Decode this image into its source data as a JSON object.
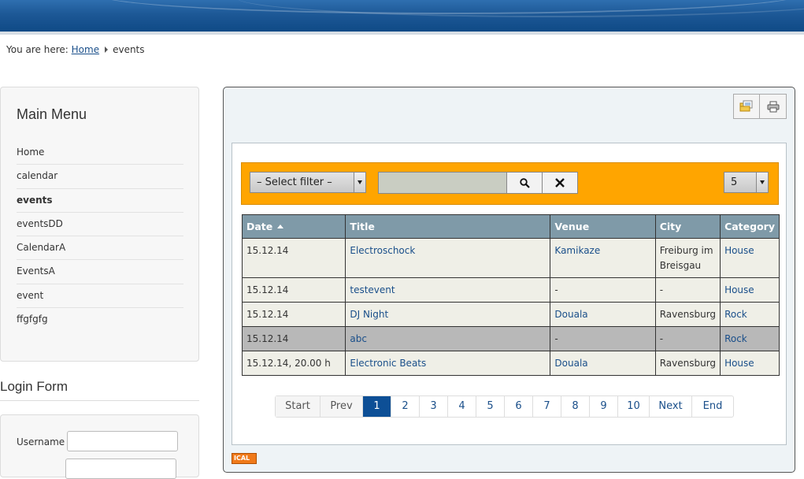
{
  "breadcrumb": {
    "prefix": "You are here:",
    "home": "Home",
    "current": "events"
  },
  "main_menu": {
    "title": "Main Menu",
    "items": [
      "Home",
      "calendar",
      "events",
      "eventsDD",
      "CalendarA",
      "EventsA",
      "event",
      "ffgfgfg"
    ],
    "active": "events"
  },
  "login": {
    "title": "Login Form",
    "username_label": "Username"
  },
  "toolbar": {
    "export_icon": "folder-export-icon",
    "print_icon": "print-icon"
  },
  "filter": {
    "select_label": "– Select filter –",
    "search_value": "",
    "limit_value": "5"
  },
  "table": {
    "headers": {
      "date": "Date",
      "title": "Title",
      "venue": "Venue",
      "city": "City",
      "category": "Category"
    },
    "rows": [
      {
        "date": "15.12.14",
        "title": "Electroschock",
        "venue": "Kamikaze",
        "city": "Freiburg im Breisgau",
        "category": "House"
      },
      {
        "date": "15.12.14",
        "title": "testevent",
        "venue": "-",
        "city": "-",
        "category": "House"
      },
      {
        "date": "15.12.14",
        "title": "DJ Night",
        "venue": "Douala",
        "city": "Ravensburg",
        "category": "Rock"
      },
      {
        "date": "15.12.14",
        "title": "abc",
        "venue": "-",
        "city": "-",
        "category": "Rock"
      },
      {
        "date": "15.12.14, 20.00 h",
        "title": "Electronic Beats",
        "venue": "Douala",
        "city": "Ravensburg",
        "category": "House"
      }
    ]
  },
  "pagination": {
    "start": "Start",
    "prev": "Prev",
    "pages": [
      "1",
      "2",
      "3",
      "4",
      "5",
      "6",
      "7",
      "8",
      "9",
      "10"
    ],
    "current": "1",
    "next": "Next",
    "end": "End"
  },
  "ical": "ICAL",
  "colors": {
    "banner": "#1d5896",
    "filter_bar": "#ffa500",
    "table_header": "#7f9aa8",
    "link": "#1a4f8a",
    "page_current": "#0d4f96"
  }
}
